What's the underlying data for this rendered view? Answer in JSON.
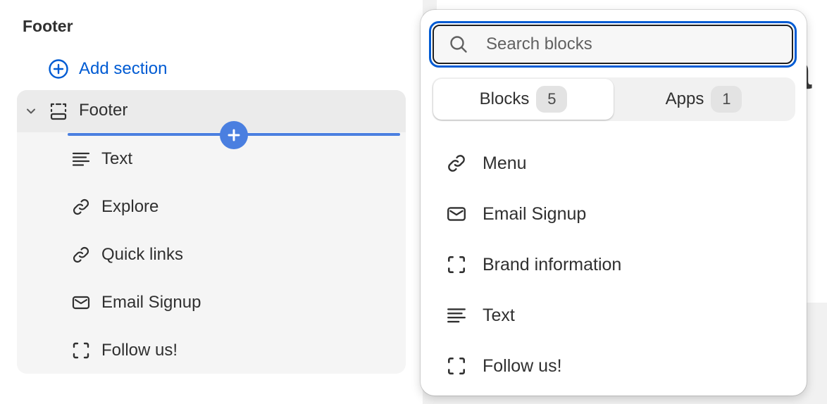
{
  "sidebar": {
    "group_title": "Footer",
    "add_section_label": "Add section",
    "section": {
      "label": "Footer",
      "blocks": [
        {
          "label": "Text",
          "icon": "text-icon"
        },
        {
          "label": "Explore",
          "icon": "link-icon"
        },
        {
          "label": "Quick links",
          "icon": "link-icon"
        },
        {
          "label": "Email Signup",
          "icon": "email-icon"
        },
        {
          "label": "Follow us!",
          "icon": "dashed-square-icon"
        }
      ]
    }
  },
  "popover": {
    "search": {
      "value": "",
      "placeholder": "Search blocks"
    },
    "tabs": [
      {
        "label": "Blocks",
        "count": "5",
        "active": true
      },
      {
        "label": "Apps",
        "count": "1",
        "active": false
      }
    ],
    "items": [
      {
        "label": "Menu",
        "icon": "link-icon"
      },
      {
        "label": "Email Signup",
        "icon": "email-icon"
      },
      {
        "label": "Brand information",
        "icon": "dashed-square-icon"
      },
      {
        "label": "Text",
        "icon": "text-icon"
      },
      {
        "label": "Follow us!",
        "icon": "dashed-square-icon"
      }
    ]
  },
  "preview": {
    "visible_glyph": "a"
  },
  "colors": {
    "accent": "#005bd3",
    "insert_line": "#4a7fe0",
    "text": "#303030"
  }
}
